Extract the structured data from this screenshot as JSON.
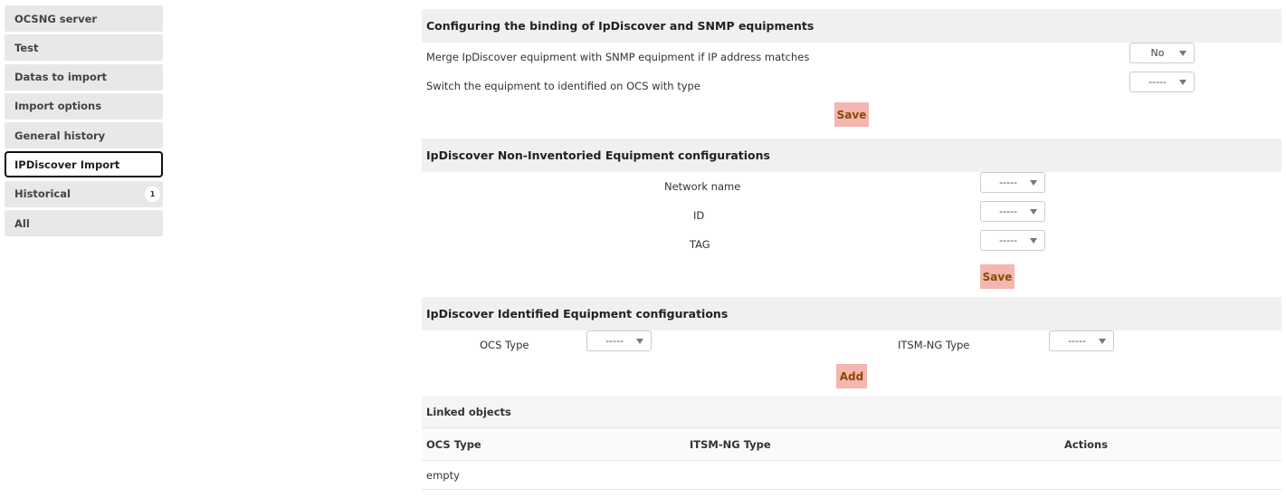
{
  "sidebar": {
    "items": [
      {
        "label": "OCSNG server"
      },
      {
        "label": "Test"
      },
      {
        "label": "Datas to import"
      },
      {
        "label": "Import options"
      },
      {
        "label": "General history"
      },
      {
        "label": "IPDiscover Import"
      },
      {
        "label": "Historical",
        "badge": "1"
      },
      {
        "label": "All"
      }
    ],
    "active": "IPDiscover Import"
  },
  "binding": {
    "title": "Configuring the binding of IpDiscover and SNMP equipments",
    "merge_label": "Merge IpDiscover equipment with SNMP equipment if IP address matches",
    "merge_value": "No",
    "switch_label": "Switch the equipment to identified on OCS with type",
    "switch_value": "-----",
    "save_label": "Save"
  },
  "non_inventoried": {
    "title": "IpDiscover Non-Inventoried Equipment configurations",
    "network_name_label": "Network name",
    "network_name_value": "-----",
    "id_label": "ID",
    "id_value": "-----",
    "tag_label": "TAG",
    "tag_value": "-----",
    "save_label": "Save"
  },
  "identified": {
    "title": "IpDiscover Identified Equipment configurations",
    "ocs_type_label": "OCS Type",
    "ocs_type_value": "-----",
    "itsm_type_label": "ITSM-NG Type",
    "itsm_type_value": "-----",
    "add_label": "Add"
  },
  "linked": {
    "title": "Linked objects",
    "columns": [
      "OCS Type",
      "ITSM-NG Type",
      "Actions"
    ],
    "empty_text": "empty"
  },
  "colors": {
    "button_bg": "#f4b6b0",
    "button_text": "#8a4a00",
    "header_bg": "#f0f0f0",
    "sidebar_bg": "#e8e8e8"
  }
}
